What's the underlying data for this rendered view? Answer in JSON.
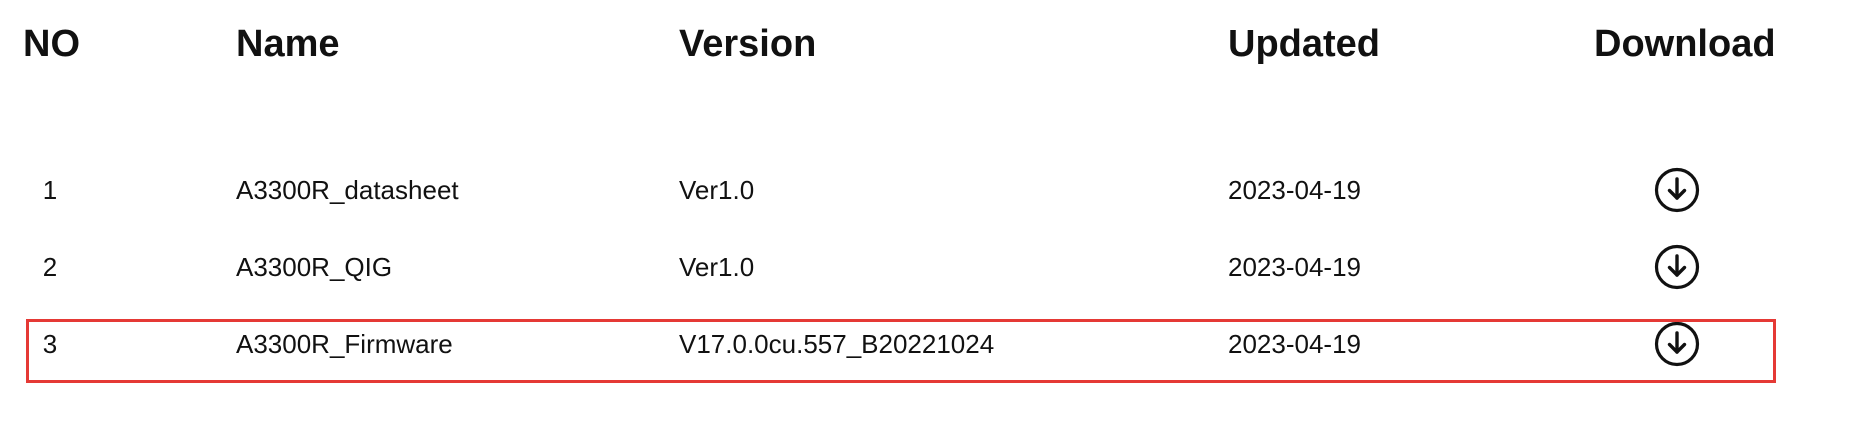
{
  "table": {
    "headers": {
      "no": "NO",
      "name": "Name",
      "version": "Version",
      "updated": "Updated",
      "download": "Download"
    },
    "rows": [
      {
        "no": "1",
        "name": "A3300R_datasheet",
        "version": "Ver1.0",
        "updated": "2023-04-19",
        "download_icon": "download-circle-icon"
      },
      {
        "no": "2",
        "name": "A3300R_QIG",
        "version": "Ver1.0",
        "updated": "2023-04-19",
        "download_icon": "download-circle-icon"
      },
      {
        "no": "3",
        "name": "A3300R_Firmware",
        "version": "V17.0.0cu.557_B20221024",
        "updated": "2023-04-19",
        "download_icon": "download-circle-icon",
        "highlighted": true
      }
    ]
  },
  "colors": {
    "text": "#111111",
    "highlight_border": "#e53935",
    "background": "#ffffff"
  }
}
